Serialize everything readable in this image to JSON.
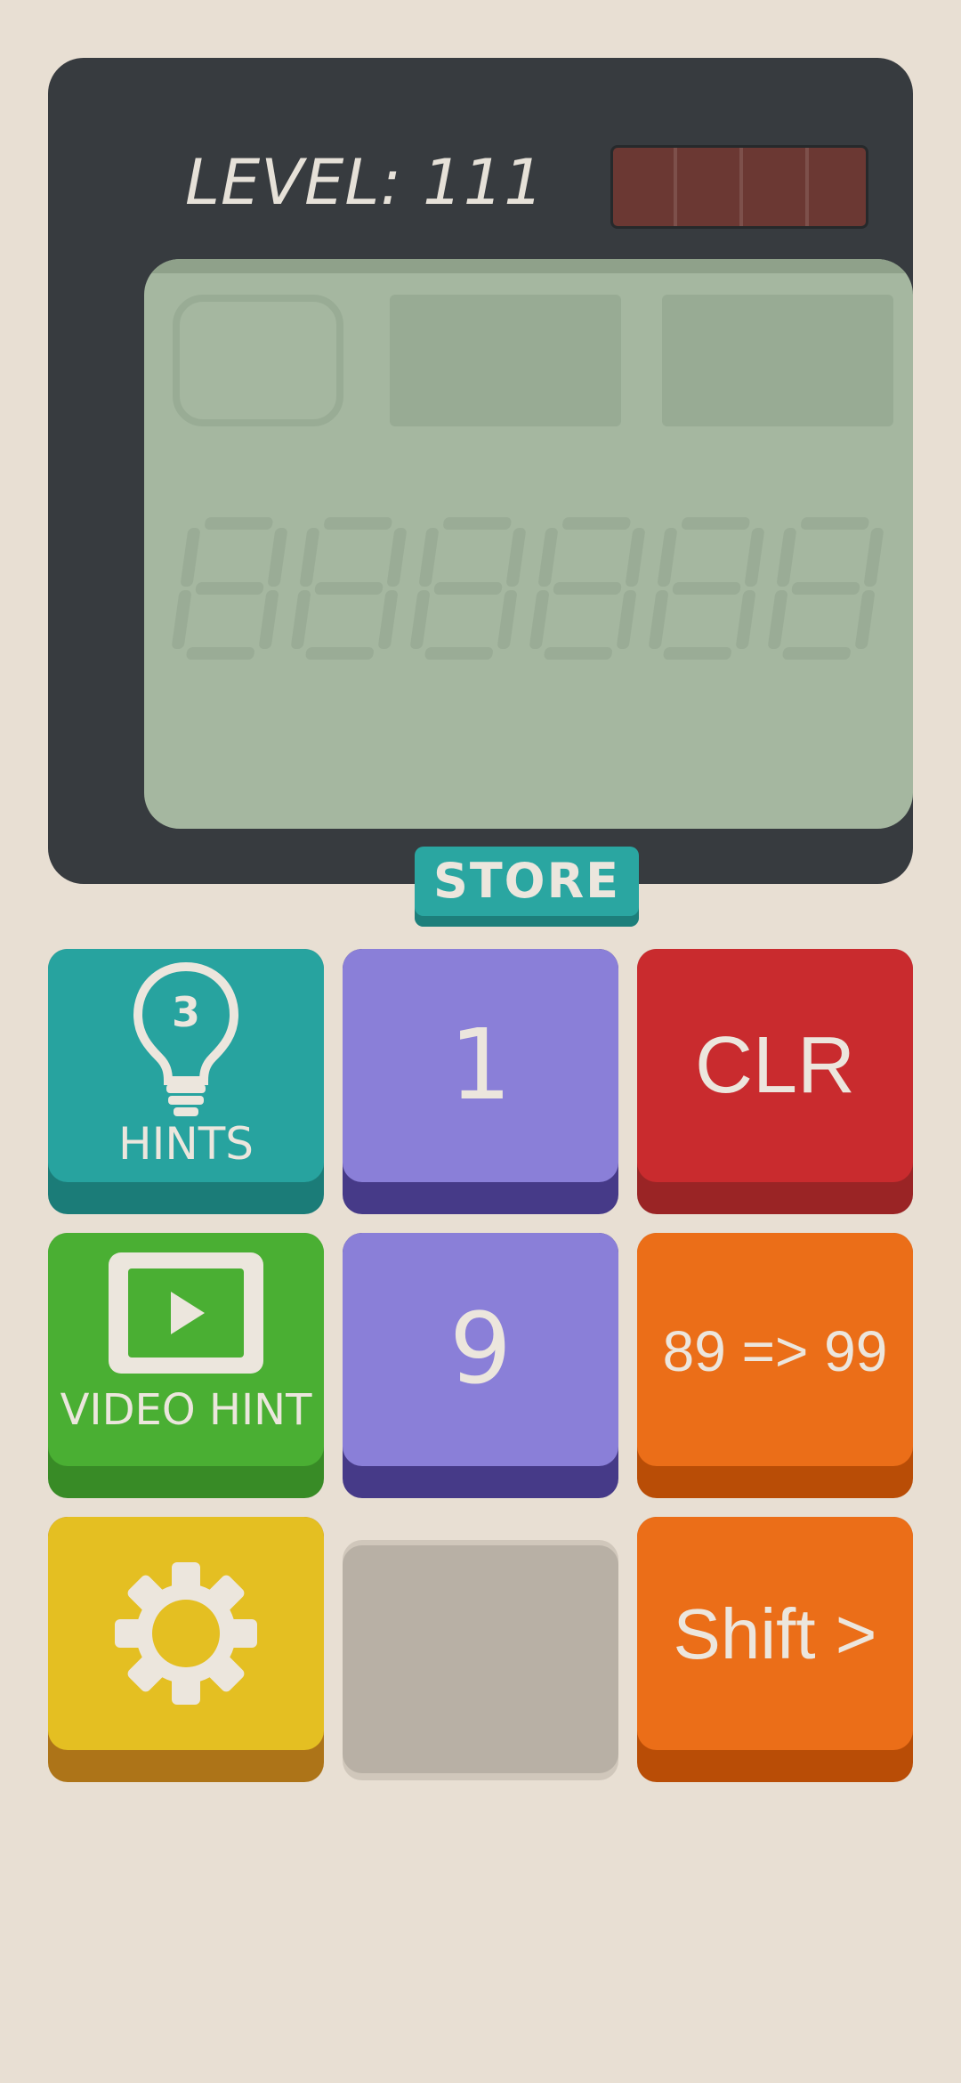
{
  "header": {
    "level_text": "LEVEL: 111"
  },
  "screen": {
    "digit_count": 6
  },
  "store_button": {
    "label": "STORE",
    "color": "#2aa6a1"
  },
  "keypad": {
    "hints": {
      "label": "HINTS",
      "count": "3",
      "icon": "lightbulb-icon",
      "color": "#27a39f"
    },
    "button_1": {
      "label": "1",
      "color": "#8a7fd8"
    },
    "clear": {
      "label": "CLR",
      "color": "#c92b2e"
    },
    "video_hint": {
      "label": "VIDEO HINT",
      "icon": "play-video-icon",
      "color": "#4aaf33"
    },
    "button_9": {
      "label": "9",
      "color": "#8a7fd8"
    },
    "replace": {
      "label": "89 => 99",
      "color": "#eb6e18"
    },
    "settings": {
      "icon": "gear-icon",
      "color": "#e4bf22"
    },
    "empty": {
      "color": "#b8b0a5"
    },
    "shift": {
      "label": "Shift >",
      "color": "#eb6e18"
    }
  },
  "colors": {
    "background": "#e8dfd3",
    "calculator_body": "#373b3f",
    "lcd": "#a5b7a0",
    "battery": "#6b3833",
    "text_light": "#ece6dd"
  }
}
